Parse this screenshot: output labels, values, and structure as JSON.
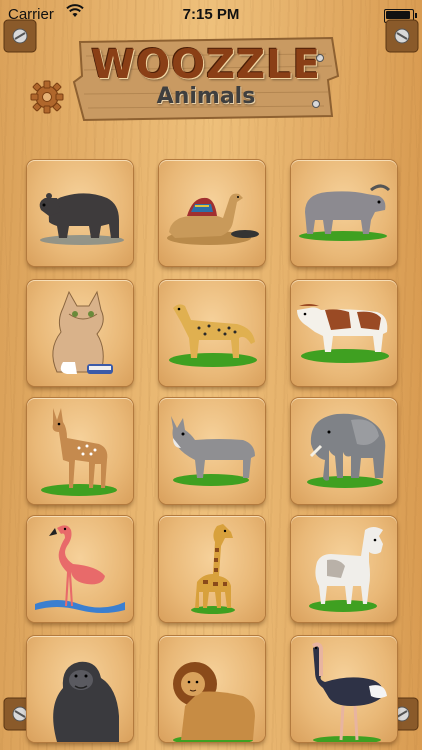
{
  "status_bar": {
    "carrier": "Carrier",
    "time": "7:15 PM"
  },
  "header": {
    "title": "WOOZZLE",
    "subtitle": "Animals"
  },
  "icons": {
    "settings": "gear-icon",
    "wifi": "wifi-icon",
    "battery": "battery-icon",
    "hinge": "hinge-screw-icon"
  },
  "animals": [
    "bear",
    "camel",
    "water buffalo",
    "cat",
    "cheetah",
    "cow",
    "deer",
    "donkey",
    "elephant",
    "flamingo",
    "giraffe",
    "goat",
    "gorilla",
    "lion",
    "ostrich"
  ],
  "colors": {
    "wood_light": "#eec07b",
    "wood_dark": "#d99c52",
    "title_brown": "#8a3f16",
    "grass": "#3fa021"
  }
}
